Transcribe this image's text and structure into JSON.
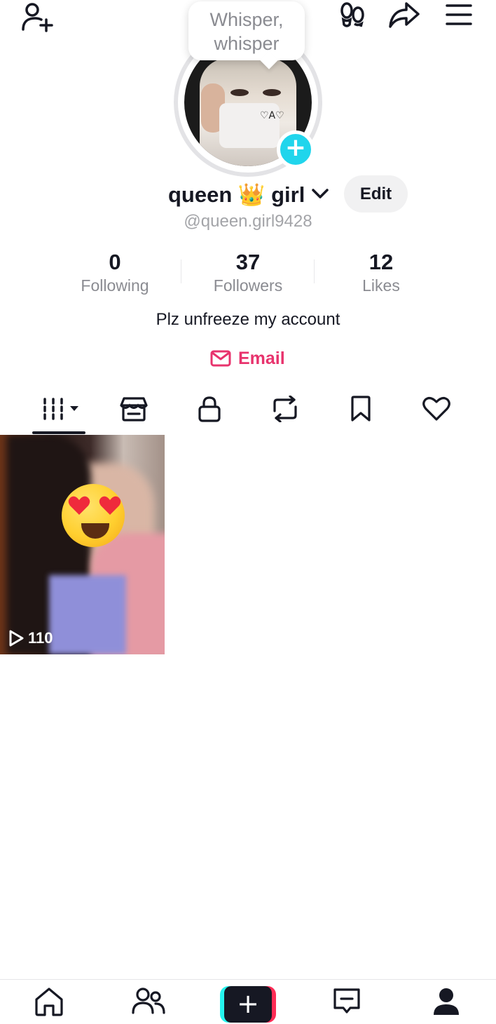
{
  "story_bubble": {
    "line1": "Whisper,",
    "line2": "whisper"
  },
  "avatar": {
    "veil_text": "♡A♡"
  },
  "profile": {
    "display_name": "queen 👑 girl",
    "edit_label": "Edit",
    "username": "@queen.girl9428",
    "bio": "Plz unfreeze my account",
    "email_label": "Email"
  },
  "stats": [
    {
      "value": "0",
      "label": "Following"
    },
    {
      "value": "37",
      "label": "Followers"
    },
    {
      "value": "12",
      "label": "Likes"
    }
  ],
  "tabs": [
    {
      "icon": "grid-icon",
      "active": true
    },
    {
      "icon": "shop-icon"
    },
    {
      "icon": "lock-icon"
    },
    {
      "icon": "repost-icon"
    },
    {
      "icon": "bookmark-icon"
    },
    {
      "icon": "heart-icon"
    }
  ],
  "videos": [
    {
      "views": "110"
    }
  ],
  "bottom_nav": [
    {
      "icon": "home-icon"
    },
    {
      "icon": "friends-icon"
    },
    {
      "icon": "create-icon",
      "symbol": "+"
    },
    {
      "icon": "inbox-icon"
    },
    {
      "icon": "profile-icon"
    }
  ],
  "colors": {
    "accent_pink": "#e8336d",
    "add_story_blue": "#20d5ec",
    "text_primary": "#161823",
    "text_secondary": "#8a8b91"
  }
}
